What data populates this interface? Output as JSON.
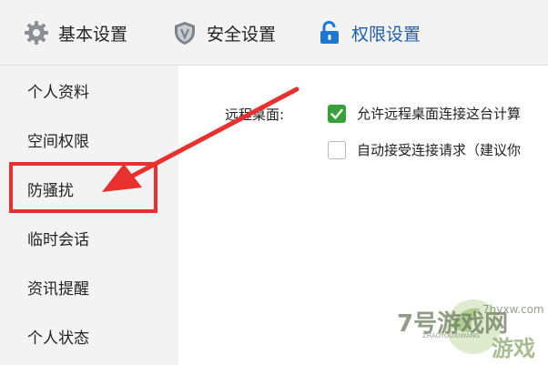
{
  "tabs": [
    {
      "label": "基本设置",
      "icon": "gear-icon"
    },
    {
      "label": "安全设置",
      "icon": "shield-icon"
    },
    {
      "label": "权限设置",
      "icon": "lock-icon"
    }
  ],
  "active_tab_color": "#1f5fae",
  "sidebar": {
    "items": [
      {
        "label": "个人资料"
      },
      {
        "label": "空间权限"
      },
      {
        "label": "防骚扰"
      },
      {
        "label": "临时会话"
      },
      {
        "label": "资讯提醒"
      },
      {
        "label": "个人状态"
      }
    ]
  },
  "remote_desktop": {
    "label": "远程桌面:",
    "options": [
      {
        "label": "允许远程桌面连接这台计算",
        "checked": true
      },
      {
        "label": "自动接受连接请求（建议你",
        "checked": false
      }
    ]
  },
  "annotation": {
    "color": "#e8302f"
  },
  "watermark": {
    "brand": "7号游戏网",
    "domain": "7hyxw.com",
    "pinyin": "ZHAOYOUXIWANG",
    "tagline": "游戏"
  }
}
